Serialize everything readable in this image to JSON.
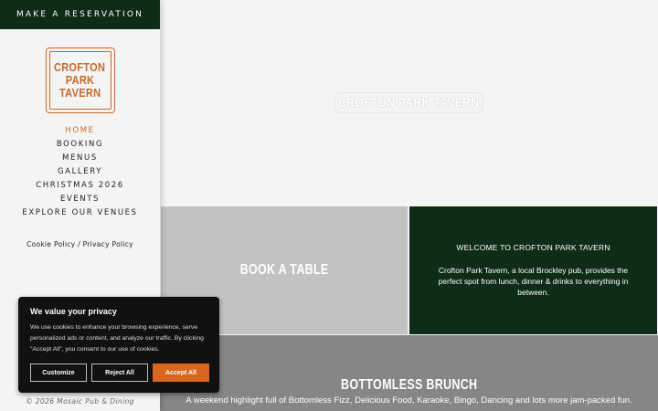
{
  "sidebar": {
    "reserve_label": "MAKE A RESERVATION",
    "logo_lines": [
      "CROFTON",
      "PARK",
      "TAVERN"
    ],
    "nav": [
      {
        "label": "HOME",
        "active": true
      },
      {
        "label": "BOOKING"
      },
      {
        "label": "MENUS"
      },
      {
        "label": "GALLERY"
      },
      {
        "label": "CHRISTMAS 2026"
      },
      {
        "label": "EVENTS"
      },
      {
        "label": "EXPLORE OUR VENUES"
      }
    ],
    "policy_links": "Cookie Policy / Privacy Policy",
    "copyright": "© 2026 Mosaic Pub & Dining"
  },
  "hero": {
    "title": "CROFTON PARK TAVERN"
  },
  "book": {
    "title": "BOOK A TABLE"
  },
  "welcome": {
    "title": "WELCOME TO CROFTON PARK TAVERN",
    "text": "Crofton Park Tavern, a local Brockley pub, provides the perfect spot from lunch, dinner & drinks to everything in between."
  },
  "brunch": {
    "title": "BOTTOMLESS BRUNCH",
    "text": "A weekend highlight full of Bottomless Fizz, Delicious Food, Karaoke, Bingo, Dancing and lots more jam-packed fun."
  },
  "cookie": {
    "title": "We value your privacy",
    "text": "We use cookies to enhance your browsing experience, serve personalized ads or content, and analyze our traffic. By clicking \"Accept All\", you consent to our use of cookies.",
    "customize_label": "Customize",
    "reject_label": "Reject All",
    "accept_label": "Accept All"
  },
  "colors": {
    "brand_green": "#0f2c16",
    "accent_orange": "#c76a2a",
    "accept_orange": "#d8661e"
  }
}
